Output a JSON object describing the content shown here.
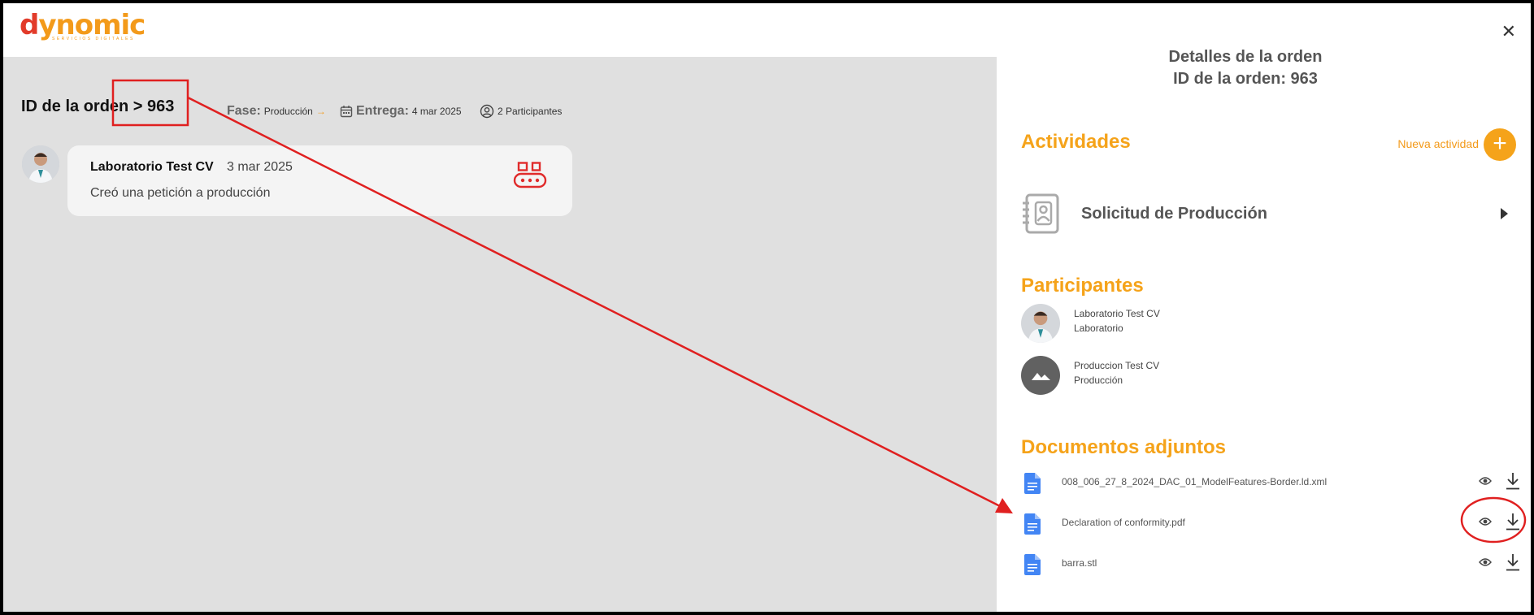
{
  "logo": {
    "main_d": "d",
    "main_rest": "ynomic",
    "sub": "SERVICIOS DIGITALES"
  },
  "order": {
    "header": "ID de la orden > 963",
    "fase_label": "Fase:",
    "fase_value": "Producción",
    "entrega_label": "Entrega:",
    "entrega_value": "4 mar 2025",
    "participants": "2 Participantes"
  },
  "activity": {
    "name": "Laboratorio Test CV",
    "date": "3 mar 2025",
    "description": "Creó una petición a producción",
    "icon": "conveyor-icon"
  },
  "panel": {
    "title": "Detalles de la orden",
    "subtitle": "ID de la orden: 963",
    "activities_title": "Actividades",
    "new_activity": "Nueva actividad",
    "activity_item": "Solicitud de Producción",
    "participants_title": "Participantes",
    "participants": [
      {
        "name": "Laboratorio Test CV",
        "role": "Laboratorio"
      },
      {
        "name": "Produccion Test CV",
        "role": "Producción"
      }
    ],
    "documents_title": "Documentos adjuntos",
    "documents": [
      {
        "name": "008_006_27_8_2024_DAC_01_ModelFeatures-Border.ld.xml"
      },
      {
        "name": "Declaration of conformity.pdf"
      },
      {
        "name": "barra.stl"
      }
    ]
  },
  "colors": {
    "accent": "#f5a31a",
    "annotation": "#e02020",
    "doc_blue": "#4285f4"
  }
}
